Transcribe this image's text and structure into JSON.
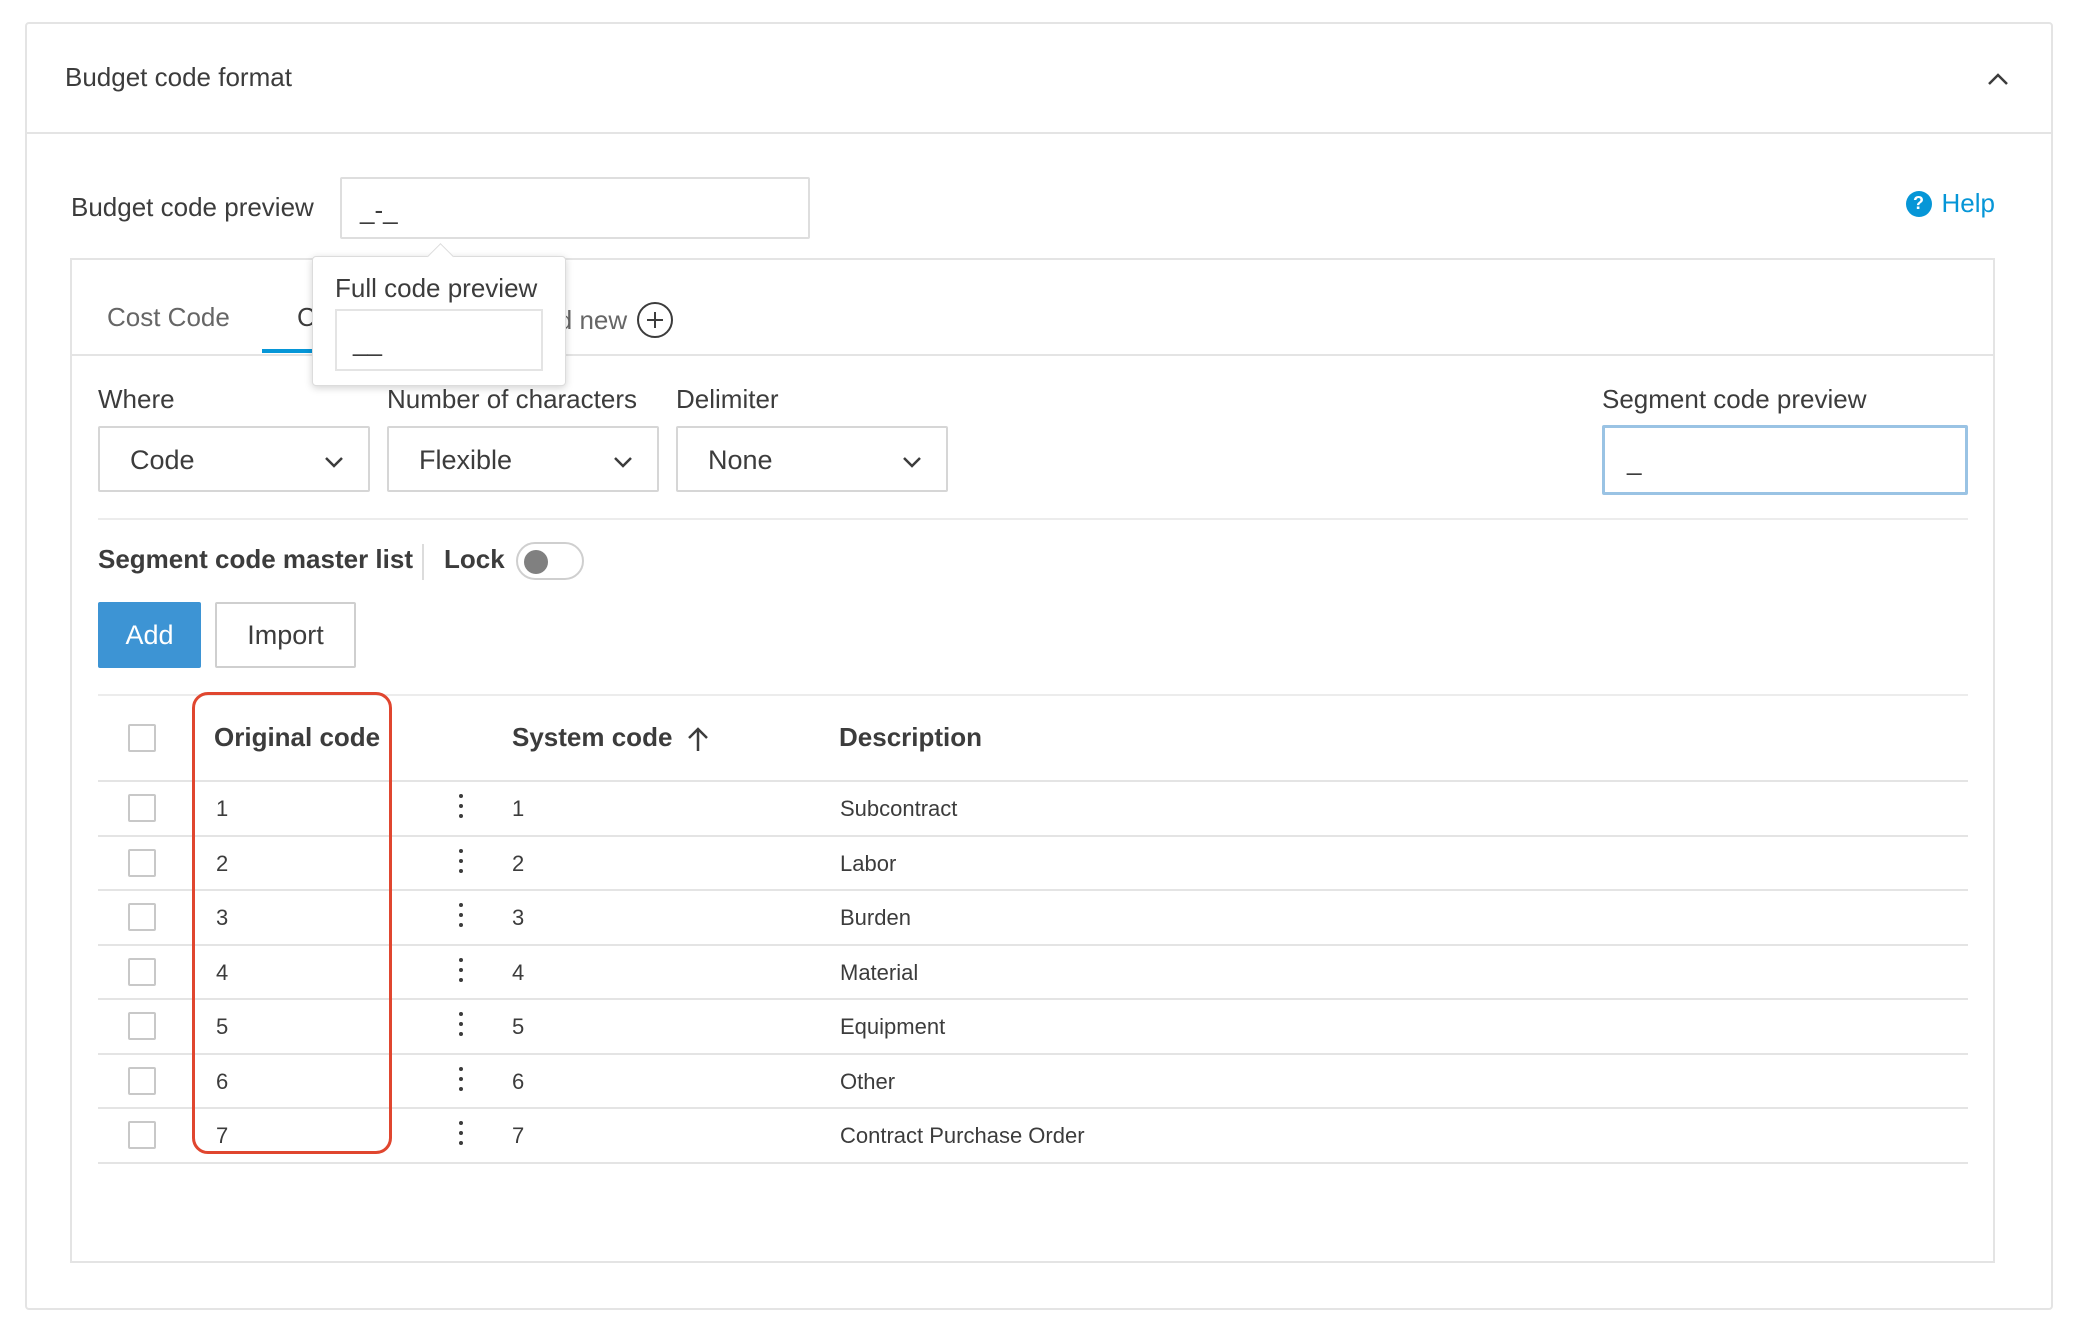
{
  "panel": {
    "title": "Budget code format"
  },
  "preview": {
    "label": "Budget code preview",
    "value": "_-_"
  },
  "help": {
    "label": "Help",
    "icon_glyph": "?"
  },
  "tabs": {
    "cost_code": "Cost Code",
    "active": "C",
    "add_new": "ld new"
  },
  "popover": {
    "title": "Full code preview",
    "value": "__"
  },
  "fields": {
    "where_label": "Where",
    "where_value": "Code",
    "chars_label": "Number of characters",
    "chars_value": "Flexible",
    "delimiter_label": "Delimiter",
    "delimiter_value": "None",
    "segment_preview_label": "Segment code preview",
    "segment_preview_value": "_"
  },
  "master": {
    "title": "Segment code master list",
    "lock_label": "Lock",
    "lock_on": false
  },
  "buttons": {
    "add": "Add",
    "import": "Import"
  },
  "table": {
    "headers": {
      "original": "Original code",
      "system": "System code",
      "description": "Description"
    },
    "rows": [
      {
        "original": "1",
        "system": "1",
        "description": "Subcontract"
      },
      {
        "original": "2",
        "system": "2",
        "description": "Labor"
      },
      {
        "original": "3",
        "system": "3",
        "description": "Burden"
      },
      {
        "original": "4",
        "system": "4",
        "description": "Material"
      },
      {
        "original": "5",
        "system": "5",
        "description": "Equipment"
      },
      {
        "original": "6",
        "system": "6",
        "description": "Other"
      },
      {
        "original": "7",
        "system": "7",
        "description": "Contract Purchase Order"
      }
    ]
  },
  "colors": {
    "accent": "#0696d7",
    "button_primary": "#3d94d4",
    "highlight": "#e0462f"
  }
}
